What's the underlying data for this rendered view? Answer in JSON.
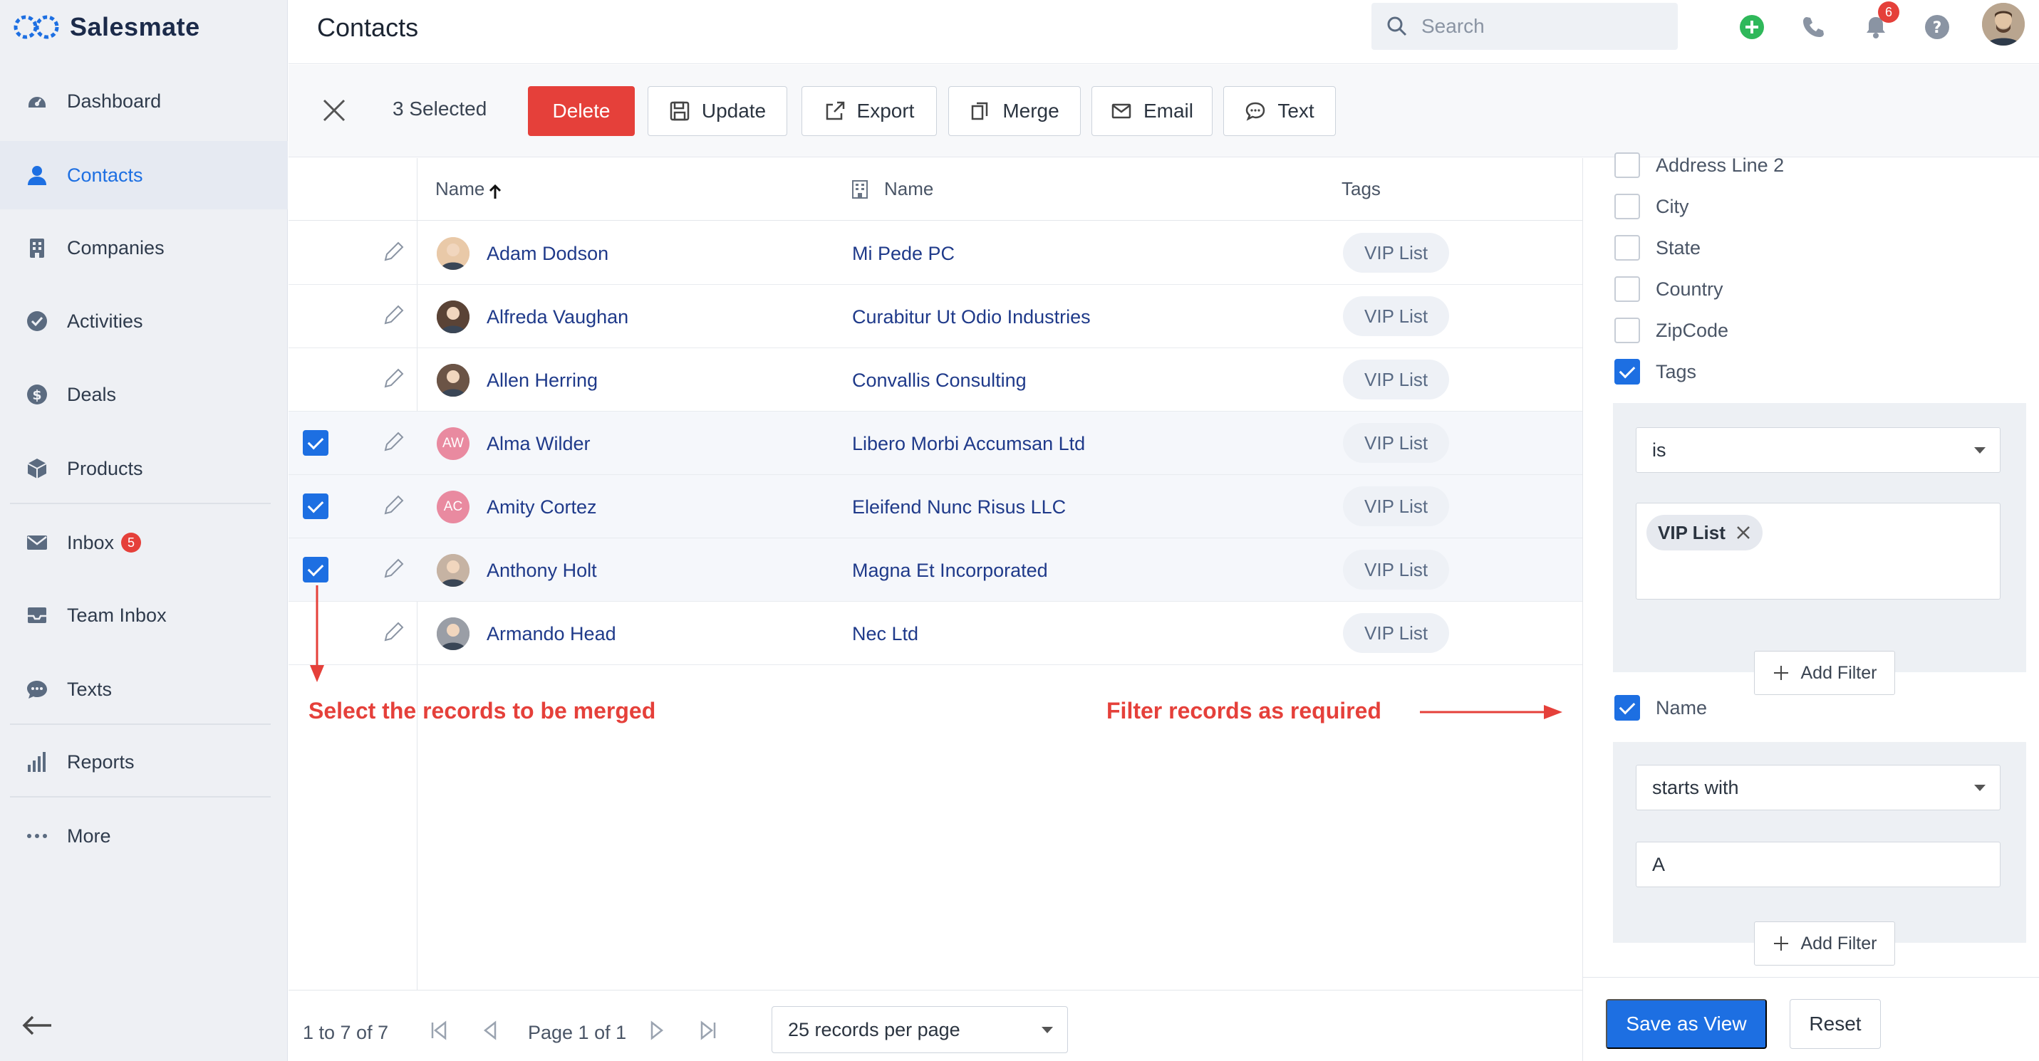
{
  "app": {
    "name": "Salesmate"
  },
  "colors": {
    "accent": "#1d6fe2",
    "danger": "#e5403a",
    "link": "#1f3a8a"
  },
  "sidebar": {
    "items": [
      {
        "label": "Dashboard",
        "icon": "dashboard-icon"
      },
      {
        "label": "Contacts",
        "icon": "user-icon",
        "active": true
      },
      {
        "label": "Companies",
        "icon": "building-icon"
      },
      {
        "label": "Activities",
        "icon": "check-circle-icon"
      },
      {
        "label": "Deals",
        "icon": "dollar-icon"
      },
      {
        "label": "Products",
        "icon": "box-icon"
      },
      {
        "label": "Inbox",
        "icon": "mail-icon",
        "badge": "5"
      },
      {
        "label": "Team Inbox",
        "icon": "inbox-tray-icon"
      },
      {
        "label": "Texts",
        "icon": "chat-bubble-icon"
      },
      {
        "label": "Reports",
        "icon": "bar-chart-icon"
      },
      {
        "label": "More",
        "icon": "more-dots-icon"
      }
    ]
  },
  "header": {
    "title": "Contacts",
    "search_placeholder": "Search",
    "notification_count": "6"
  },
  "actionbar": {
    "selected": "3 Selected",
    "delete": "Delete",
    "update": "Update",
    "export": "Export",
    "merge": "Merge",
    "email": "Email",
    "text": "Text"
  },
  "table": {
    "columns": {
      "name": "Name",
      "company": "Name",
      "tags": "Tags"
    },
    "rows": [
      {
        "name": "Adam Dodson",
        "company": "Mi Pede PC",
        "tag": "VIP List",
        "checked": false,
        "initials": ""
      },
      {
        "name": "Alfreda Vaughan",
        "company": "Curabitur Ut Odio Industries",
        "tag": "VIP List",
        "checked": false,
        "initials": ""
      },
      {
        "name": "Allen Herring",
        "company": "Convallis Consulting",
        "tag": "VIP List",
        "checked": false,
        "initials": ""
      },
      {
        "name": "Alma Wilder",
        "company": "Libero Morbi Accumsan Ltd",
        "tag": "VIP List",
        "checked": true,
        "initials": "AW"
      },
      {
        "name": "Amity Cortez",
        "company": "Eleifend Nunc Risus LLC",
        "tag": "VIP List",
        "checked": true,
        "initials": "AC"
      },
      {
        "name": "Anthony Holt",
        "company": "Magna Et Incorporated",
        "tag": "VIP List",
        "checked": true,
        "initials": ""
      },
      {
        "name": "Armando Head",
        "company": "Nec Ltd",
        "tag": "VIP List",
        "checked": false,
        "initials": ""
      }
    ]
  },
  "annotations": {
    "left": "Select the records to be merged",
    "right": "Filter records as required"
  },
  "footer": {
    "range": "1 to 7 of 7",
    "page": "Page 1 of 1",
    "per_page": "25 records per page"
  },
  "filter_panel": {
    "fields": [
      {
        "label": "Address Line 2",
        "checked": false
      },
      {
        "label": "City",
        "checked": false
      },
      {
        "label": "State",
        "checked": false
      },
      {
        "label": "Country",
        "checked": false
      },
      {
        "label": "ZipCode",
        "checked": false
      },
      {
        "label": "Tags",
        "checked": true
      }
    ],
    "tags_filter": {
      "operator": "is",
      "chip": "VIP List",
      "add_filter": "Add Filter"
    },
    "name_field": {
      "label": "Name",
      "checked": true
    },
    "name_filter": {
      "operator": "starts with",
      "value": "A",
      "add_filter": "Add Filter"
    },
    "save_view": "Save as View",
    "reset": "Reset"
  }
}
